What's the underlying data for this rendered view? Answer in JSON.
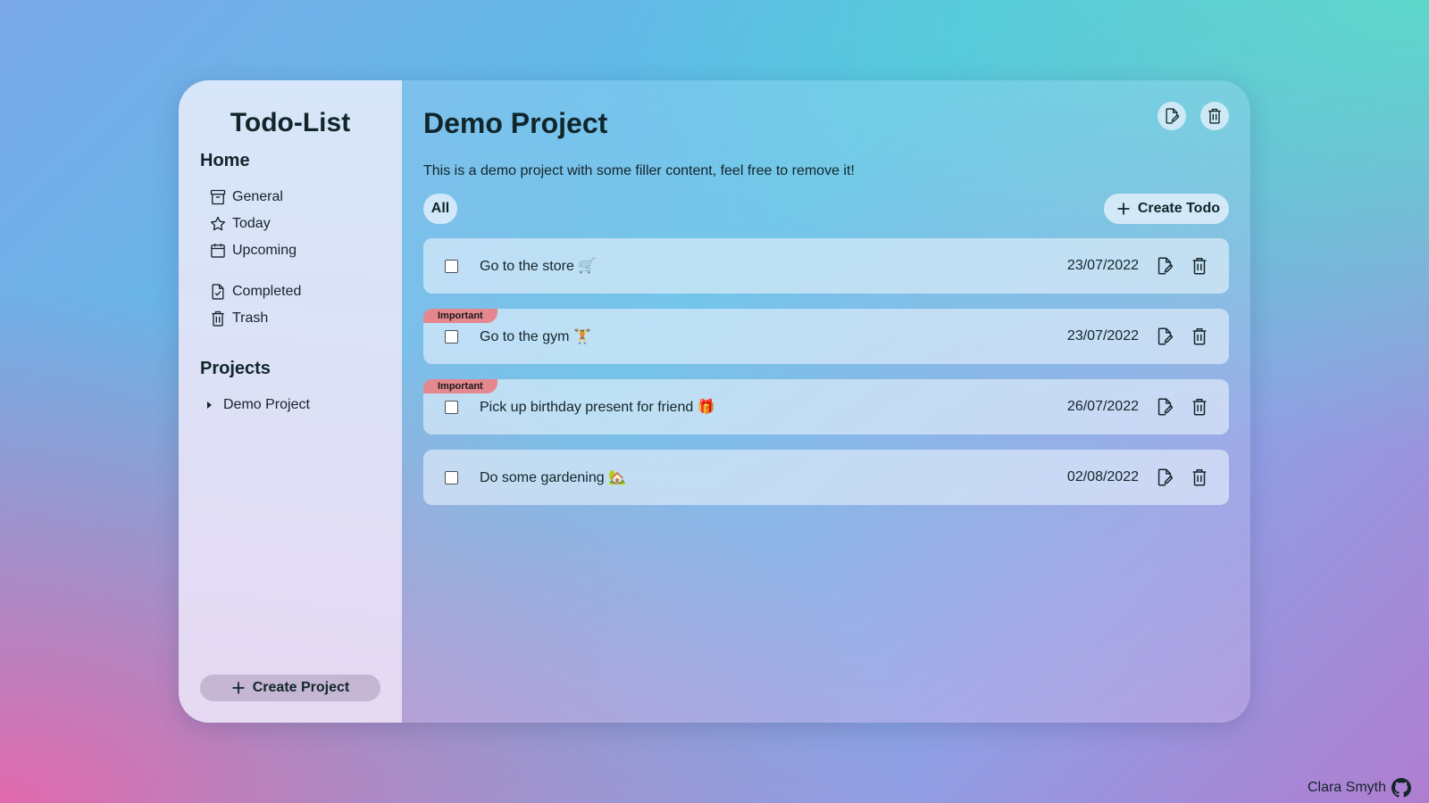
{
  "app": {
    "title": "Todo-List"
  },
  "sidebar": {
    "home_title": "Home",
    "items": [
      {
        "label": "General",
        "icon": "archive-icon"
      },
      {
        "label": "Today",
        "icon": "star-icon"
      },
      {
        "label": "Upcoming",
        "icon": "calendar-icon"
      },
      {
        "label": "Completed",
        "icon": "file-check-icon"
      },
      {
        "label": "Trash",
        "icon": "trash-icon"
      }
    ],
    "projects_title": "Projects",
    "projects": [
      {
        "label": "Demo Project"
      }
    ],
    "create_project_label": "Create Project"
  },
  "main": {
    "title": "Demo Project",
    "description": "This is a demo project with some filler content, feel free to remove it!",
    "filter_label": "All",
    "create_todo_label": "Create Todo",
    "todos": [
      {
        "text": "Go to the store 🛒",
        "date": "23/07/2022",
        "badge": ""
      },
      {
        "text": "Go to the gym 🏋",
        "date": "23/07/2022",
        "badge": "Important"
      },
      {
        "text": "Pick up birthday present for friend 🎁",
        "date": "26/07/2022",
        "badge": "Important"
      },
      {
        "text": "Do some gardening 🏡",
        "date": "02/08/2022",
        "badge": ""
      }
    ]
  },
  "footer": {
    "author": "Clara Smyth",
    "icon": "github-icon"
  },
  "colors": {
    "badge": "#e5878f",
    "text": "#14252b"
  }
}
